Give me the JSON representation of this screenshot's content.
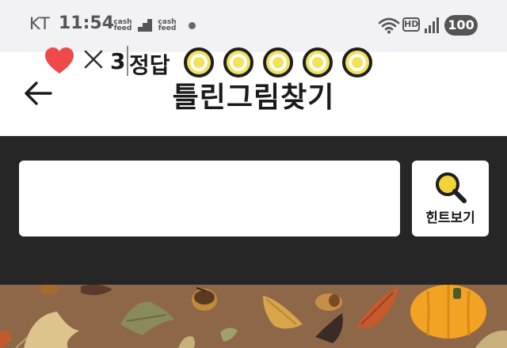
{
  "status_bar": {
    "carrier": "KT",
    "time": "11:54",
    "notification_label": "cash feed",
    "network_badge": "HD",
    "battery": "100",
    "icons": [
      "cashfeed-icon",
      "stairs-icon",
      "cashfeed-icon",
      "dot-icon",
      "wifi-icon",
      "signal-icon"
    ]
  },
  "header": {
    "title": "틀린그림찾기",
    "back_icon": "arrow-left-icon"
  },
  "game": {
    "lives_icon": "heart-icon",
    "lives_count": "3",
    "answer_label": "정답",
    "answers_found": 0,
    "answers_total": 5,
    "hint_label": "힌트보기",
    "hint_icon": "magnifier-icon"
  },
  "colors": {
    "panel_bg": "#262626",
    "heart": "#ef4a4a",
    "answer_circle": "#f2e15a",
    "magnifier": "#f2d33a",
    "puzzle_bg": "#8e6749"
  }
}
